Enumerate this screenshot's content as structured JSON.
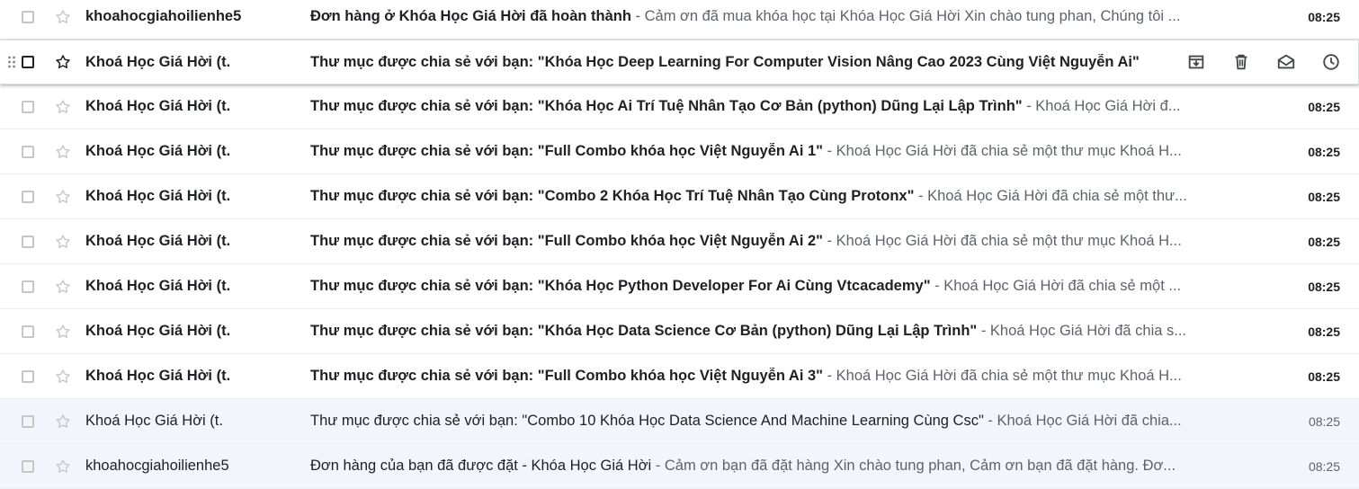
{
  "emails": [
    {
      "sender": "khoahocgiahoilienhe5",
      "subject": "Đơn hàng ở Khóa Học Giá Hời đã hoàn thành",
      "snippet": " - Cảm ơn đã mua khóa học tại Khóa Học Giá Hời Xin chào tung phan, Chúng tôi ...",
      "time": "08:25"
    },
    {
      "sender": "Khoá Học Giá Hời (t.",
      "subject": "Thư mục được chia sẻ với bạn: \"Khóa Học Deep Learning For Computer Vision Nâng Cao 2023 Cùng Việt Nguyễn Ai\"",
      "snippet": "",
      "time": ""
    },
    {
      "sender": "Khoá Học Giá Hời (t.",
      "subject": "Thư mục được chia sẻ với bạn: \"Khóa Học Ai Trí Tuệ Nhân Tạo Cơ Bản (python) Dũng Lại Lập Trình\"",
      "snippet": " - Khoá Học Giá Hời đ...",
      "time": "08:25"
    },
    {
      "sender": "Khoá Học Giá Hời (t.",
      "subject": "Thư mục được chia sẻ với bạn: \"Full Combo khóa học Việt Nguyễn Ai 1\"",
      "snippet": " - Khoá Học Giá Hời đã chia sẻ một thư mục Khoá H...",
      "time": "08:25"
    },
    {
      "sender": "Khoá Học Giá Hời (t.",
      "subject": "Thư mục được chia sẻ với bạn: \"Combo 2 Khóa Học Trí Tuệ Nhân Tạo Cùng Protonx\"",
      "snippet": " - Khoá Học Giá Hời đã chia sẻ một thư...",
      "time": "08:25"
    },
    {
      "sender": "Khoá Học Giá Hời (t.",
      "subject": "Thư mục được chia sẻ với bạn: \"Full Combo khóa học Việt Nguyễn Ai 2\"",
      "snippet": " - Khoá Học Giá Hời đã chia sẻ một thư mục Khoá H...",
      "time": "08:25"
    },
    {
      "sender": "Khoá Học Giá Hời (t.",
      "subject": "Thư mục được chia sẻ với bạn: \"Khóa Học Python Developer For Ai Cùng Vtcacademy\"",
      "snippet": " - Khoá Học Giá Hời đã chia sẻ một ...",
      "time": "08:25"
    },
    {
      "sender": "Khoá Học Giá Hời (t.",
      "subject": "Thư mục được chia sẻ với bạn: \"Khóa Học Data Science Cơ Bản (python) Dũng Lại Lập Trình\"",
      "snippet": " - Khoá Học Giá Hời đã chia s...",
      "time": "08:25"
    },
    {
      "sender": "Khoá Học Giá Hời (t.",
      "subject": "Thư mục được chia sẻ với bạn: \"Full Combo khóa học Việt Nguyễn Ai 3\"",
      "snippet": " - Khoá Học Giá Hời đã chia sẻ một thư mục Khoá H...",
      "time": "08:25"
    },
    {
      "sender": "Khoá Học Giá Hời (t.",
      "subject": "Thư mục được chia sẻ với bạn: \"Combo 10 Khóa Học Data Science And Machine Learning Cùng Csc\"",
      "snippet": " - Khoá Học Giá Hời đã chia...",
      "time": "08:25"
    },
    {
      "sender": "khoahocgiahoilienhe5",
      "subject": "Đơn hàng của bạn đã được đặt - Khóa Học Giá Hời",
      "snippet": " - Cảm ơn bạn đã đặt hàng Xin chào tung phan, Cảm ơn bạn đã đặt hàng. Đơ...",
      "time": "08:25"
    }
  ],
  "hover_actions": [
    "archive-icon",
    "trash-icon",
    "mark-unread-icon",
    "snooze-icon"
  ]
}
